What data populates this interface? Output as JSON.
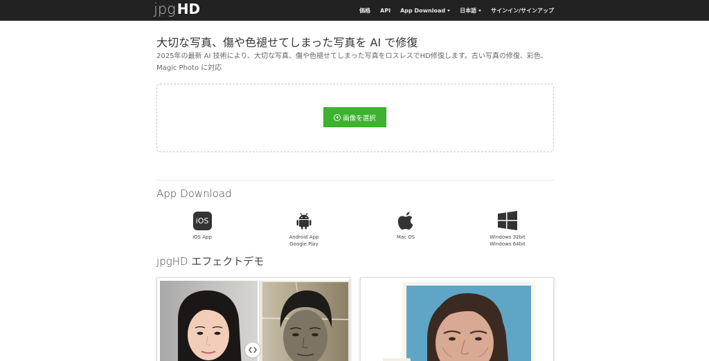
{
  "nav": {
    "logo_jpg": "jpg",
    "logo_hd": "HD",
    "links": [
      {
        "label": "価格"
      },
      {
        "label": "API"
      },
      {
        "label": "App Download"
      },
      {
        "label": "日本語"
      },
      {
        "label": "サインイン/サインアップ"
      }
    ]
  },
  "hero": {
    "title": "大切な写真、傷や色褪せてしまった写真を AI で修復",
    "description": "2025年の最新 AI 技術により、大切な写真、傷や色褪せてしまった写真をロスレスでHD修復します。古い写真の修復、彩色、Magic Photo に対応",
    "upload_button": "画像を選択"
  },
  "app_download": {
    "title": "App Download",
    "items": [
      {
        "icon": "ios-icon",
        "icon_text": "iOS",
        "line1": "iOS App",
        "line2": ""
      },
      {
        "icon": "android-icon",
        "line1": "Android App",
        "line2": "Google Play"
      },
      {
        "icon": "apple-icon",
        "line1": "Mac OS",
        "line2": ""
      },
      {
        "icon": "windows-icon",
        "line1": "Windows 32bit",
        "line2": "Windows 64bit"
      }
    ]
  },
  "demo": {
    "title": "jpgHD エフェクトデモ"
  },
  "colors": {
    "navbar": "#222222",
    "button_green": "#3cb32d",
    "text": "#333333"
  }
}
